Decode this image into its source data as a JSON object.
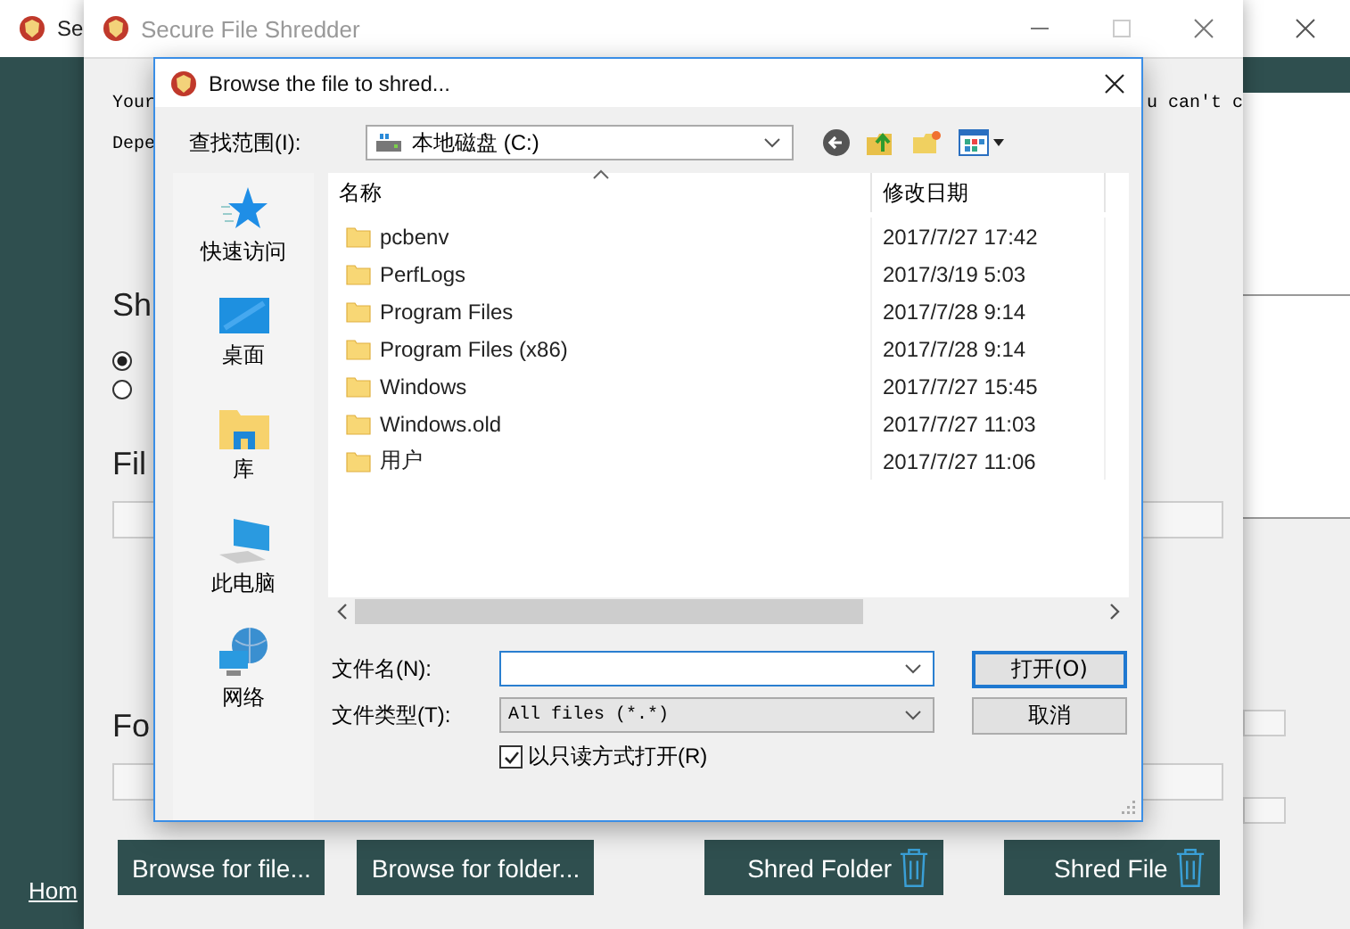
{
  "back_window": {
    "title": "Se",
    "home_link": "Hom"
  },
  "main_window": {
    "title": "Secure File Shredder",
    "intro_lines": [
      {
        "left": "Your",
        "right": "u can't c"
      },
      {
        "left": "Depe"
      }
    ],
    "shred_heading": "Sh",
    "radios": [
      {
        "selected": true
      },
      {
        "selected": false
      }
    ],
    "file_heading": "Fil",
    "folder_heading": "Fo",
    "buttons": [
      {
        "label": "Browse for file...",
        "kind": "browse"
      },
      {
        "label": "Browse for folder...",
        "kind": "browse"
      },
      {
        "label": "Shred Folder",
        "kind": "shred"
      },
      {
        "label": "Shred File",
        "kind": "shred"
      }
    ]
  },
  "dialog": {
    "title": "Browse the file to shred...",
    "look_in_label": "查找范围(I):",
    "look_in_value": "本地磁盘 (C:)",
    "places": [
      {
        "label": "快速访问",
        "kind": "star"
      },
      {
        "label": "桌面",
        "kind": "desktop"
      },
      {
        "label": "库",
        "kind": "library"
      },
      {
        "label": "此电脑",
        "kind": "computer"
      },
      {
        "label": "网络",
        "kind": "network"
      }
    ],
    "columns": [
      "名称",
      "修改日期"
    ],
    "rows": [
      {
        "name": "pcbenv",
        "date": "2017/7/27 17:42"
      },
      {
        "name": "PerfLogs",
        "date": "2017/3/19 5:03"
      },
      {
        "name": "Program Files",
        "date": "2017/7/28 9:14"
      },
      {
        "name": "Program Files (x86)",
        "date": "2017/7/28 9:14"
      },
      {
        "name": "Windows",
        "date": "2017/7/27 15:45"
      },
      {
        "name": "Windows.old",
        "date": "2017/7/27 11:03"
      },
      {
        "name": "用户",
        "date": "2017/7/27 11:06"
      }
    ],
    "filename_label": "文件名(N):",
    "filetype_label": "文件类型(T):",
    "filetype_value": "All files (*.*)",
    "readonly": {
      "label": "以只读方式打开(R)",
      "checked": true
    },
    "buttons": [
      {
        "label": "打开(O)",
        "default": true
      },
      {
        "label": "取消",
        "default": false
      }
    ]
  }
}
